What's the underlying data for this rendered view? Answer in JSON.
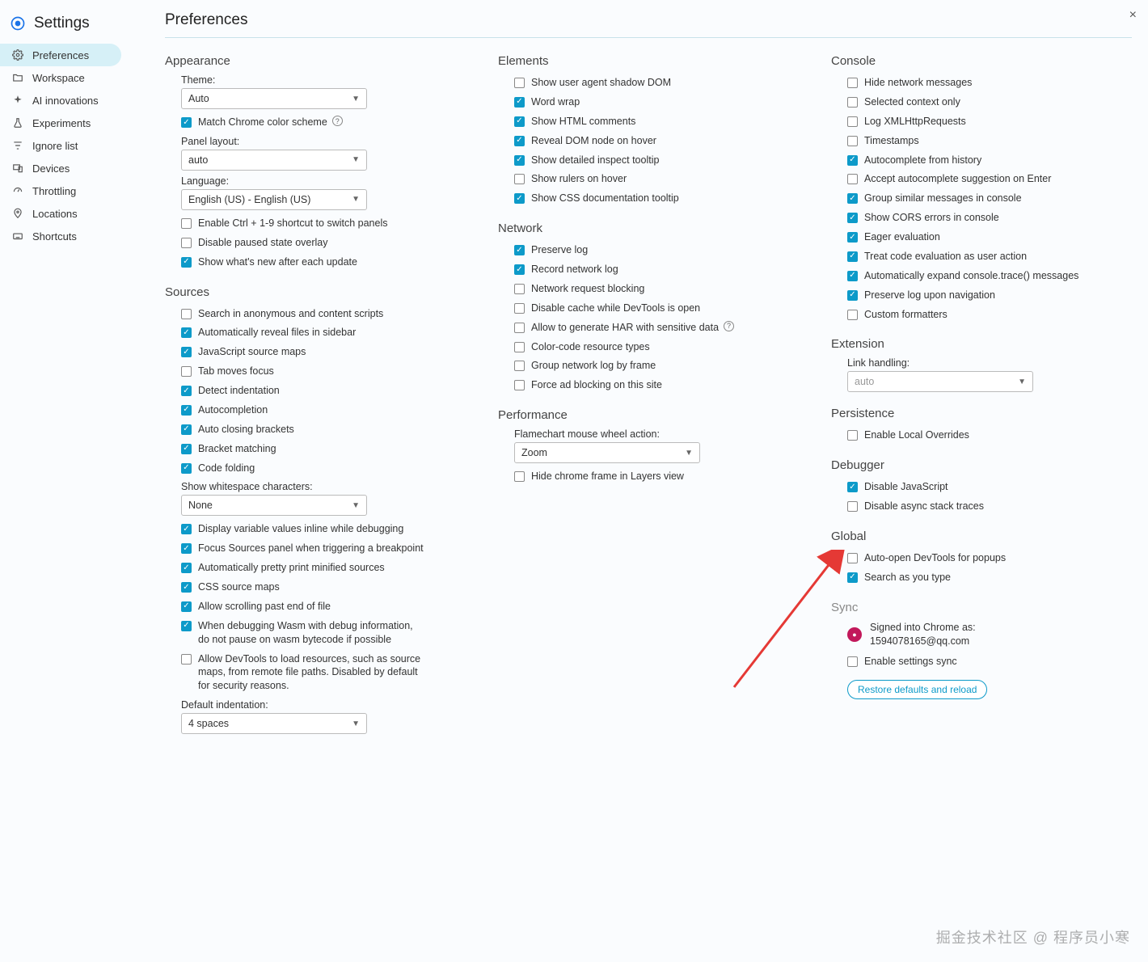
{
  "app": {
    "title": "Settings",
    "page_title": "Preferences",
    "close": "×"
  },
  "nav": [
    {
      "label": "Preferences",
      "active": true,
      "icon": "gear-icon"
    },
    {
      "label": "Workspace",
      "active": false,
      "icon": "folder-icon"
    },
    {
      "label": "AI innovations",
      "active": false,
      "icon": "sparkle-icon"
    },
    {
      "label": "Experiments",
      "active": false,
      "icon": "flask-icon"
    },
    {
      "label": "Ignore list",
      "active": false,
      "icon": "filter-icon"
    },
    {
      "label": "Devices",
      "active": false,
      "icon": "devices-icon"
    },
    {
      "label": "Throttling",
      "active": false,
      "icon": "gauge-icon"
    },
    {
      "label": "Locations",
      "active": false,
      "icon": "location-icon"
    },
    {
      "label": "Shortcuts",
      "active": false,
      "icon": "keyboard-icon"
    }
  ],
  "col1": {
    "appearance": {
      "title": "Appearance",
      "theme_label": "Theme:",
      "theme_value": "Auto",
      "match_chrome": {
        "label": "Match Chrome color scheme",
        "checked": true,
        "help": true
      },
      "panel_layout_label": "Panel layout:",
      "panel_layout_value": "auto",
      "language_label": "Language:",
      "language_value": "English (US) - English (US)",
      "items": [
        {
          "label": "Enable Ctrl + 1-9 shortcut to switch panels",
          "checked": false
        },
        {
          "label": "Disable paused state overlay",
          "checked": false
        },
        {
          "label": "Show what's new after each update",
          "checked": true
        }
      ]
    },
    "sources": {
      "title": "Sources",
      "items1": [
        {
          "label": "Search in anonymous and content scripts",
          "checked": false
        },
        {
          "label": "Automatically reveal files in sidebar",
          "checked": true
        },
        {
          "label": "JavaScript source maps",
          "checked": true
        },
        {
          "label": "Tab moves focus",
          "checked": false
        },
        {
          "label": "Detect indentation",
          "checked": true
        },
        {
          "label": "Autocompletion",
          "checked": true
        },
        {
          "label": "Auto closing brackets",
          "checked": true
        },
        {
          "label": "Bracket matching",
          "checked": true
        },
        {
          "label": "Code folding",
          "checked": true
        }
      ],
      "whitespace_label": "Show whitespace characters:",
      "whitespace_value": "None",
      "items2": [
        {
          "label": "Display variable values inline while debugging",
          "checked": true
        },
        {
          "label": "Focus Sources panel when triggering a breakpoint",
          "checked": true
        },
        {
          "label": "Automatically pretty print minified sources",
          "checked": true
        },
        {
          "label": "CSS source maps",
          "checked": true
        },
        {
          "label": "Allow scrolling past end of file",
          "checked": true
        },
        {
          "label": "When debugging Wasm with debug information, do not pause on wasm bytecode if possible",
          "checked": true
        },
        {
          "label": "Allow DevTools to load resources, such as source maps, from remote file paths. Disabled by default for security reasons.",
          "checked": false
        }
      ],
      "indent_label": "Default indentation:",
      "indent_value": "4 spaces"
    }
  },
  "col2": {
    "elements": {
      "title": "Elements",
      "items": [
        {
          "label": "Show user agent shadow DOM",
          "checked": false
        },
        {
          "label": "Word wrap",
          "checked": true
        },
        {
          "label": "Show HTML comments",
          "checked": true
        },
        {
          "label": "Reveal DOM node on hover",
          "checked": true
        },
        {
          "label": "Show detailed inspect tooltip",
          "checked": true
        },
        {
          "label": "Show rulers on hover",
          "checked": false
        },
        {
          "label": "Show CSS documentation tooltip",
          "checked": true
        }
      ]
    },
    "network": {
      "title": "Network",
      "items": [
        {
          "label": "Preserve log",
          "checked": true
        },
        {
          "label": "Record network log",
          "checked": true
        },
        {
          "label": "Network request blocking",
          "checked": false
        },
        {
          "label": "Disable cache while DevTools is open",
          "checked": false
        },
        {
          "label": "Allow to generate HAR with sensitive data",
          "checked": false,
          "help": true
        },
        {
          "label": "Color-code resource types",
          "checked": false
        },
        {
          "label": "Group network log by frame",
          "checked": false
        },
        {
          "label": "Force ad blocking on this site",
          "checked": false
        }
      ]
    },
    "performance": {
      "title": "Performance",
      "flame_label": "Flamechart mouse wheel action:",
      "flame_value": "Zoom",
      "items": [
        {
          "label": "Hide chrome frame in Layers view",
          "checked": false
        }
      ]
    }
  },
  "col3": {
    "console": {
      "title": "Console",
      "items": [
        {
          "label": "Hide network messages",
          "checked": false
        },
        {
          "label": "Selected context only",
          "checked": false
        },
        {
          "label": "Log XMLHttpRequests",
          "checked": false
        },
        {
          "label": "Timestamps",
          "checked": false
        },
        {
          "label": "Autocomplete from history",
          "checked": true
        },
        {
          "label": "Accept autocomplete suggestion on Enter",
          "checked": false
        },
        {
          "label": "Group similar messages in console",
          "checked": true
        },
        {
          "label": "Show CORS errors in console",
          "checked": true
        },
        {
          "label": "Eager evaluation",
          "checked": true
        },
        {
          "label": "Treat code evaluation as user action",
          "checked": true
        },
        {
          "label": "Automatically expand console.trace() messages",
          "checked": true
        },
        {
          "label": "Preserve log upon navigation",
          "checked": true
        },
        {
          "label": "Custom formatters",
          "checked": false
        }
      ]
    },
    "extension": {
      "title": "Extension",
      "link_label": "Link handling:",
      "link_value": "auto"
    },
    "persistence": {
      "title": "Persistence",
      "items": [
        {
          "label": "Enable Local Overrides",
          "checked": false
        }
      ]
    },
    "debugger": {
      "title": "Debugger",
      "items": [
        {
          "label": "Disable JavaScript",
          "checked": true
        },
        {
          "label": "Disable async stack traces",
          "checked": false
        }
      ]
    },
    "global": {
      "title": "Global",
      "items": [
        {
          "label": "Auto-open DevTools for popups",
          "checked": false
        },
        {
          "label": "Search as you type",
          "checked": true
        }
      ]
    },
    "sync": {
      "title": "Sync",
      "signed_line1": "Signed into Chrome as:",
      "signed_line2": "1594078165@qq.com",
      "items": [
        {
          "label": "Enable settings sync",
          "checked": false
        }
      ],
      "restore": "Restore defaults and reload"
    }
  },
  "watermark": "掘金技术社区 @ 程序员小寒"
}
